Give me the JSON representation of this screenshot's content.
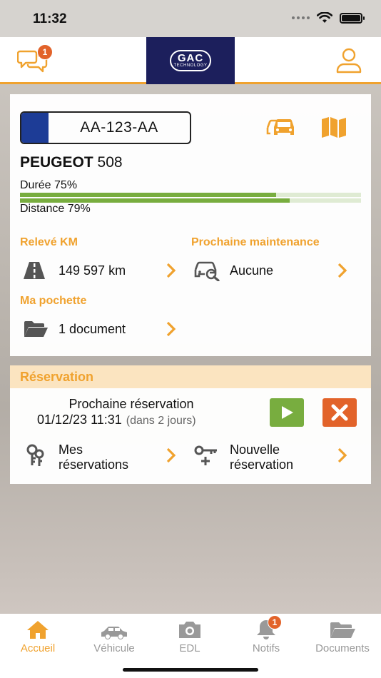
{
  "status": {
    "time": "11:32"
  },
  "header": {
    "chat_badge": "1",
    "logo_main": "GAC",
    "logo_sub": "TECHNOLOGY"
  },
  "vehicle": {
    "plate": "AA-123-AA",
    "brand": "PEUGEOT",
    "model": "508",
    "duration_label": "Durée 75%",
    "duration_value": 0.75,
    "distance_label": "Distance 79%",
    "distance_value": 0.79
  },
  "odometer": {
    "title": "Relevé KM",
    "value": "149 597 km"
  },
  "maintenance": {
    "title": "Prochaine maintenance",
    "value": "Aucune"
  },
  "pouch": {
    "title": "Ma pochette",
    "value": "1 document"
  },
  "reservation": {
    "title": "Réservation",
    "next_label": "Prochaine réservation",
    "next_date": "01/12/23 11:31",
    "next_relative": "(dans 2 jours)",
    "my_reservations_line1": "Mes",
    "my_reservations_line2": "réservations",
    "new_reservation_line1": "Nouvelle",
    "new_reservation_line2": "réservation"
  },
  "tabs": [
    {
      "label": "Accueil"
    },
    {
      "label": "Véhicule"
    },
    {
      "label": "EDL"
    },
    {
      "label": "Notifs",
      "badge": "1"
    },
    {
      "label": "Documents"
    }
  ],
  "colors": {
    "accent": "#f0a22e",
    "brand_navy": "#1c1f5c",
    "progress": "#78ad3f",
    "play": "#78ad3f",
    "cancel": "#e2632a"
  }
}
